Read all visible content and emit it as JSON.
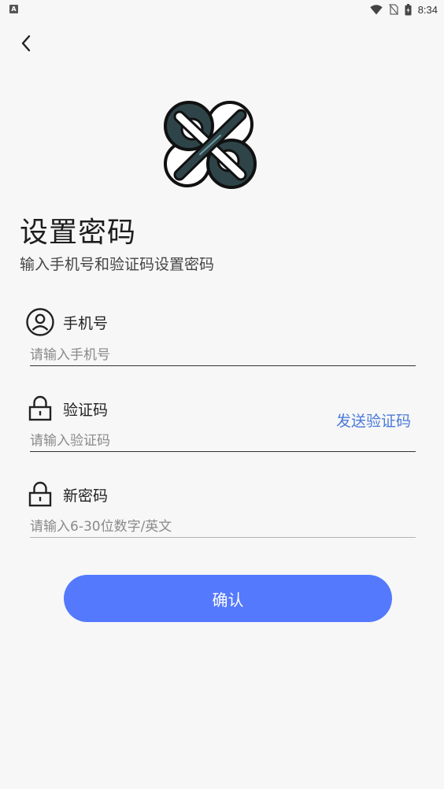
{
  "status_bar": {
    "time": "8:34",
    "app_badge": "A"
  },
  "nav": {
    "back_icon": "chevron-left-icon"
  },
  "page": {
    "title": "设置密码",
    "subtitle": "输入手机号和验证码设置密码"
  },
  "form": {
    "phone": {
      "label": "手机号",
      "icon": "user-circle-icon",
      "value": "",
      "placeholder": "请输入手机号"
    },
    "code": {
      "label": "验证码",
      "icon": "lock-icon",
      "value": "",
      "placeholder": "请输入验证码",
      "send_label": "发送验证码"
    },
    "password": {
      "label": "新密码",
      "icon": "lock-icon",
      "value": "",
      "placeholder": "请输入6-30位数字/英文"
    }
  },
  "actions": {
    "confirm_label": "确认"
  },
  "colors": {
    "accent": "#5479fc",
    "link": "#4b7bd9",
    "background": "#f7f7f8",
    "logo_dark": "#2e4448"
  }
}
